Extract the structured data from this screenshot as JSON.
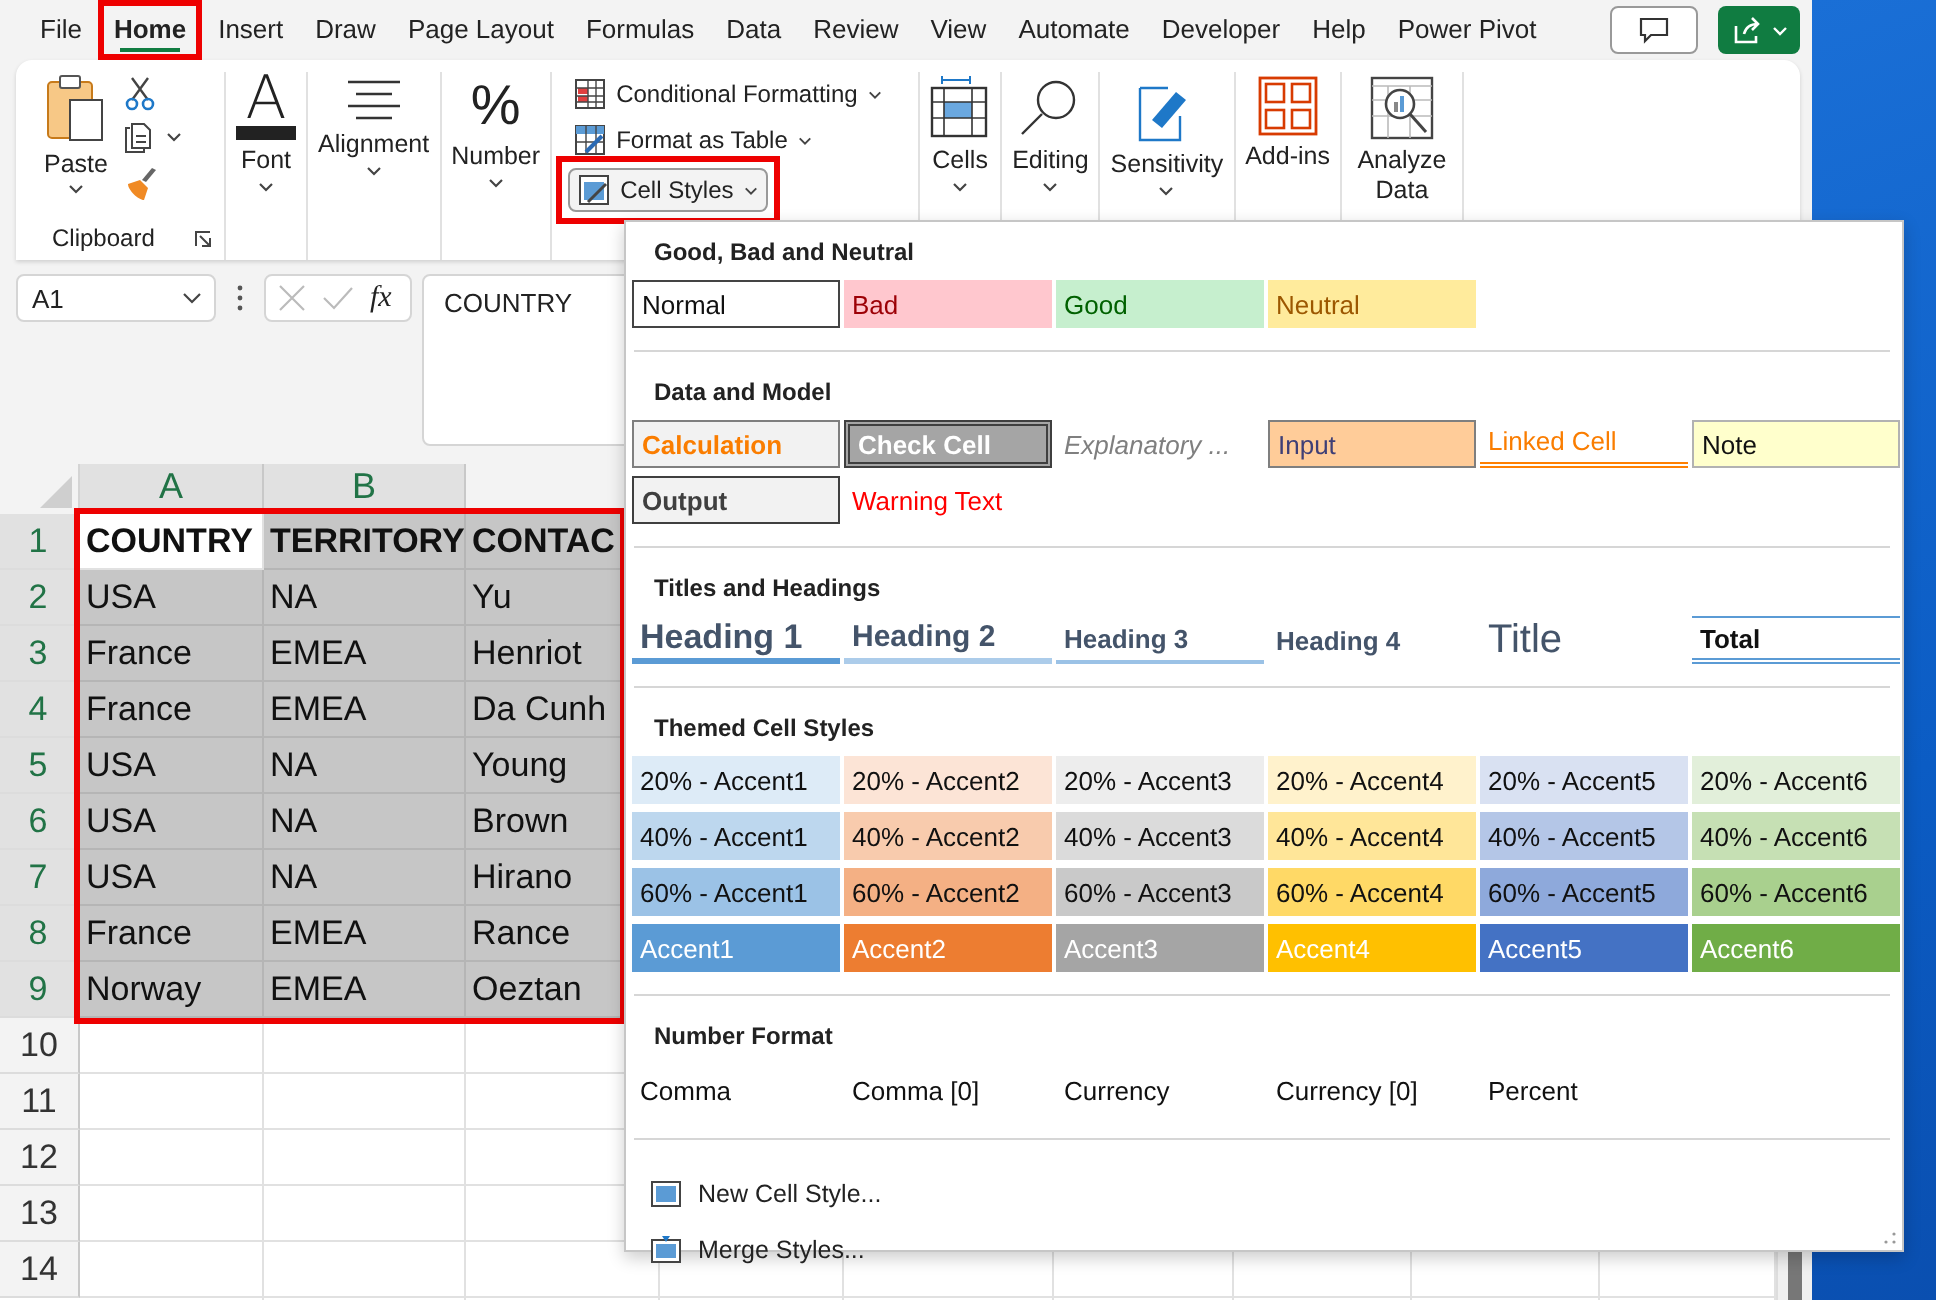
{
  "tabs": [
    {
      "label": "File",
      "selected": false,
      "highlighted": false
    },
    {
      "label": "Home",
      "selected": true,
      "highlighted": true
    },
    {
      "label": "Insert",
      "selected": false,
      "highlighted": false
    },
    {
      "label": "Draw",
      "selected": false,
      "highlighted": false
    },
    {
      "label": "Page Layout",
      "selected": false,
      "highlighted": false
    },
    {
      "label": "Formulas",
      "selected": false,
      "highlighted": false
    },
    {
      "label": "Data",
      "selected": false,
      "highlighted": false
    },
    {
      "label": "Review",
      "selected": false,
      "highlighted": false
    },
    {
      "label": "View",
      "selected": false,
      "highlighted": false
    },
    {
      "label": "Automate",
      "selected": false,
      "highlighted": false
    },
    {
      "label": "Developer",
      "selected": false,
      "highlighted": false
    },
    {
      "label": "Help",
      "selected": false,
      "highlighted": false
    },
    {
      "label": "Power Pivot",
      "selected": false,
      "highlighted": false
    }
  ],
  "ribbon": {
    "clipboard": {
      "paste": "Paste",
      "group_label": "Clipboard"
    },
    "large_left": [
      {
        "label": "Font",
        "kind": "font",
        "glyph": "A",
        "dropdown": true
      },
      {
        "label": "Alignment",
        "kind": "alignment",
        "dropdown": true
      },
      {
        "label": "Number",
        "kind": "number",
        "glyph": "%",
        "dropdown": true
      }
    ],
    "styles": [
      {
        "label": "Conditional Formatting",
        "kind": "conditional",
        "highlighted": false
      },
      {
        "label": "Format as Table",
        "kind": "table",
        "highlighted": false
      },
      {
        "label": "Cell Styles",
        "kind": "cellstyles",
        "highlighted": true
      }
    ],
    "large_right": [
      {
        "label": "Cells",
        "kind": "cells",
        "dropdown": true
      },
      {
        "label": "Editing",
        "kind": "editing",
        "dropdown": true
      },
      {
        "label": "Sensitivity",
        "kind": "sensitivity",
        "dropdown": true
      },
      {
        "label": "Add-ins",
        "kind": "addins",
        "dropdown": false
      },
      {
        "label": "Analyze Data",
        "kind": "analyze",
        "dropdown": false
      }
    ]
  },
  "formula_bar": {
    "name_box": "A1",
    "fx": "fx",
    "formula": "COUNTRY"
  },
  "sheet": {
    "columns": [
      {
        "label": "A"
      },
      {
        "label": "B"
      }
    ],
    "selection_highlighted": true,
    "rows": [
      {
        "number": "1",
        "selected": true,
        "cells": [
          {
            "text": "COUNTRY",
            "selected": false,
            "bold": true
          },
          {
            "text": "TERRITORY",
            "selected": true,
            "bold": true
          },
          {
            "text": "CONTAC",
            "selected": true,
            "bold": true
          }
        ]
      },
      {
        "number": "2",
        "selected": true,
        "cells": [
          {
            "text": "USA",
            "selected": true,
            "bold": false
          },
          {
            "text": "NA",
            "selected": true,
            "bold": false
          },
          {
            "text": "Yu",
            "selected": true,
            "bold": false
          }
        ]
      },
      {
        "number": "3",
        "selected": true,
        "cells": [
          {
            "text": "France",
            "selected": true,
            "bold": false
          },
          {
            "text": "EMEA",
            "selected": true,
            "bold": false
          },
          {
            "text": "Henriot",
            "selected": true,
            "bold": false
          }
        ]
      },
      {
        "number": "4",
        "selected": true,
        "cells": [
          {
            "text": "France",
            "selected": true,
            "bold": false
          },
          {
            "text": "EMEA",
            "selected": true,
            "bold": false
          },
          {
            "text": "Da Cunh",
            "selected": true,
            "bold": false
          }
        ]
      },
      {
        "number": "5",
        "selected": true,
        "cells": [
          {
            "text": "USA",
            "selected": true,
            "bold": false
          },
          {
            "text": "NA",
            "selected": true,
            "bold": false
          },
          {
            "text": "Young",
            "selected": true,
            "bold": false
          }
        ]
      },
      {
        "number": "6",
        "selected": true,
        "cells": [
          {
            "text": "USA",
            "selected": true,
            "bold": false
          },
          {
            "text": "NA",
            "selected": true,
            "bold": false
          },
          {
            "text": "Brown",
            "selected": true,
            "bold": false
          }
        ]
      },
      {
        "number": "7",
        "selected": true,
        "cells": [
          {
            "text": "USA",
            "selected": true,
            "bold": false
          },
          {
            "text": "NA",
            "selected": true,
            "bold": false
          },
          {
            "text": "Hirano",
            "selected": true,
            "bold": false
          }
        ]
      },
      {
        "number": "8",
        "selected": true,
        "cells": [
          {
            "text": "France",
            "selected": true,
            "bold": false
          },
          {
            "text": "EMEA",
            "selected": true,
            "bold": false
          },
          {
            "text": "Rance",
            "selected": true,
            "bold": false
          }
        ]
      },
      {
        "number": "9",
        "selected": true,
        "cells": [
          {
            "text": "Norway",
            "selected": true,
            "bold": false
          },
          {
            "text": "EMEA",
            "selected": true,
            "bold": false
          },
          {
            "text": "Oeztan",
            "selected": true,
            "bold": false
          }
        ]
      },
      {
        "number": "10",
        "selected": false,
        "cells": []
      },
      {
        "number": "11",
        "selected": false,
        "cells": []
      },
      {
        "number": "12",
        "selected": false,
        "cells": []
      },
      {
        "number": "13",
        "selected": false,
        "cells": []
      },
      {
        "number": "14",
        "selected": false,
        "cells": []
      }
    ]
  },
  "cell_styles_menu": {
    "sections": [
      {
        "title": "Good, Bad and Neutral",
        "items": [
          {
            "label": "Normal",
            "kind": "normal"
          },
          {
            "label": "Bad",
            "kind": "bad"
          },
          {
            "label": "Good",
            "kind": "good"
          },
          {
            "label": "Neutral",
            "kind": "neutral"
          }
        ]
      },
      {
        "title": "Data and Model",
        "items": [
          {
            "label": "Calculation",
            "kind": "calculation"
          },
          {
            "label": "Check Cell",
            "kind": "check"
          },
          {
            "label": "Explanatory ...",
            "kind": "explanatory"
          },
          {
            "label": "Input",
            "kind": "input"
          },
          {
            "label": "Linked Cell",
            "kind": "linked"
          },
          {
            "label": "Note",
            "kind": "note"
          },
          {
            "label": "Output",
            "kind": "output"
          },
          {
            "label": "Warning Text",
            "kind": "warning"
          }
        ]
      },
      {
        "title": "Titles and Headings",
        "items": [
          {
            "label": "Heading 1",
            "kind": "heading1"
          },
          {
            "label": "Heading 2",
            "kind": "heading2"
          },
          {
            "label": "Heading 3",
            "kind": "heading3"
          },
          {
            "label": "Heading 4",
            "kind": "heading4"
          },
          {
            "label": "Title",
            "kind": "title"
          },
          {
            "label": "Total",
            "kind": "total"
          }
        ]
      },
      {
        "title": "Themed Cell Styles",
        "items": [
          {
            "label": "20% - Accent1",
            "kind": "tint",
            "color": "#ddebf7"
          },
          {
            "label": "20% - Accent2",
            "kind": "tint",
            "color": "#fce4d6"
          },
          {
            "label": "20% - Accent3",
            "kind": "tint",
            "color": "#ededed"
          },
          {
            "label": "20% - Accent4",
            "kind": "tint",
            "color": "#fff2cc"
          },
          {
            "label": "20% - Accent5",
            "kind": "tint",
            "color": "#d9e1f2"
          },
          {
            "label": "20% - Accent6",
            "kind": "tint",
            "color": "#e2efda"
          },
          {
            "label": "40% - Accent1",
            "kind": "tint",
            "color": "#bdd7ee"
          },
          {
            "label": "40% - Accent2",
            "kind": "tint",
            "color": "#f8cbad"
          },
          {
            "label": "40% - Accent3",
            "kind": "tint",
            "color": "#dbdbdb"
          },
          {
            "label": "40% - Accent4",
            "kind": "tint",
            "color": "#ffe699"
          },
          {
            "label": "40% - Accent5",
            "kind": "tint",
            "color": "#b4c6e7"
          },
          {
            "label": "40% - Accent6",
            "kind": "tint",
            "color": "#c6e0b4"
          },
          {
            "label": "60% - Accent1",
            "kind": "tint",
            "color": "#9bc2e6"
          },
          {
            "label": "60% - Accent2",
            "kind": "tint",
            "color": "#f4b084"
          },
          {
            "label": "60% - Accent3",
            "kind": "tint",
            "color": "#c9c9c9"
          },
          {
            "label": "60% - Accent4",
            "kind": "tint",
            "color": "#ffd966"
          },
          {
            "label": "60% - Accent5",
            "kind": "tint",
            "color": "#8ea9db"
          },
          {
            "label": "60% - Accent6",
            "kind": "tint",
            "color": "#a9d08e"
          },
          {
            "label": "Accent1",
            "kind": "solid",
            "color": "#5b9bd5"
          },
          {
            "label": "Accent2",
            "kind": "solid",
            "color": "#ed7d31"
          },
          {
            "label": "Accent3",
            "kind": "solid",
            "color": "#a5a5a5"
          },
          {
            "label": "Accent4",
            "kind": "solid",
            "color": "#ffc000"
          },
          {
            "label": "Accent5",
            "kind": "solid",
            "color": "#4472c4"
          },
          {
            "label": "Accent6",
            "kind": "solid",
            "color": "#70ad47"
          }
        ]
      },
      {
        "title": "Number Format",
        "items": [
          {
            "label": "Comma",
            "kind": "plain"
          },
          {
            "label": "Comma [0]",
            "kind": "plain"
          },
          {
            "label": "Currency",
            "kind": "plain"
          },
          {
            "label": "Currency [0]",
            "kind": "plain"
          },
          {
            "label": "Percent",
            "kind": "plain"
          }
        ]
      }
    ],
    "commands": [
      {
        "label": "New Cell Style...",
        "kind": "new"
      },
      {
        "label": "Merge Styles...",
        "kind": "merge"
      }
    ]
  }
}
